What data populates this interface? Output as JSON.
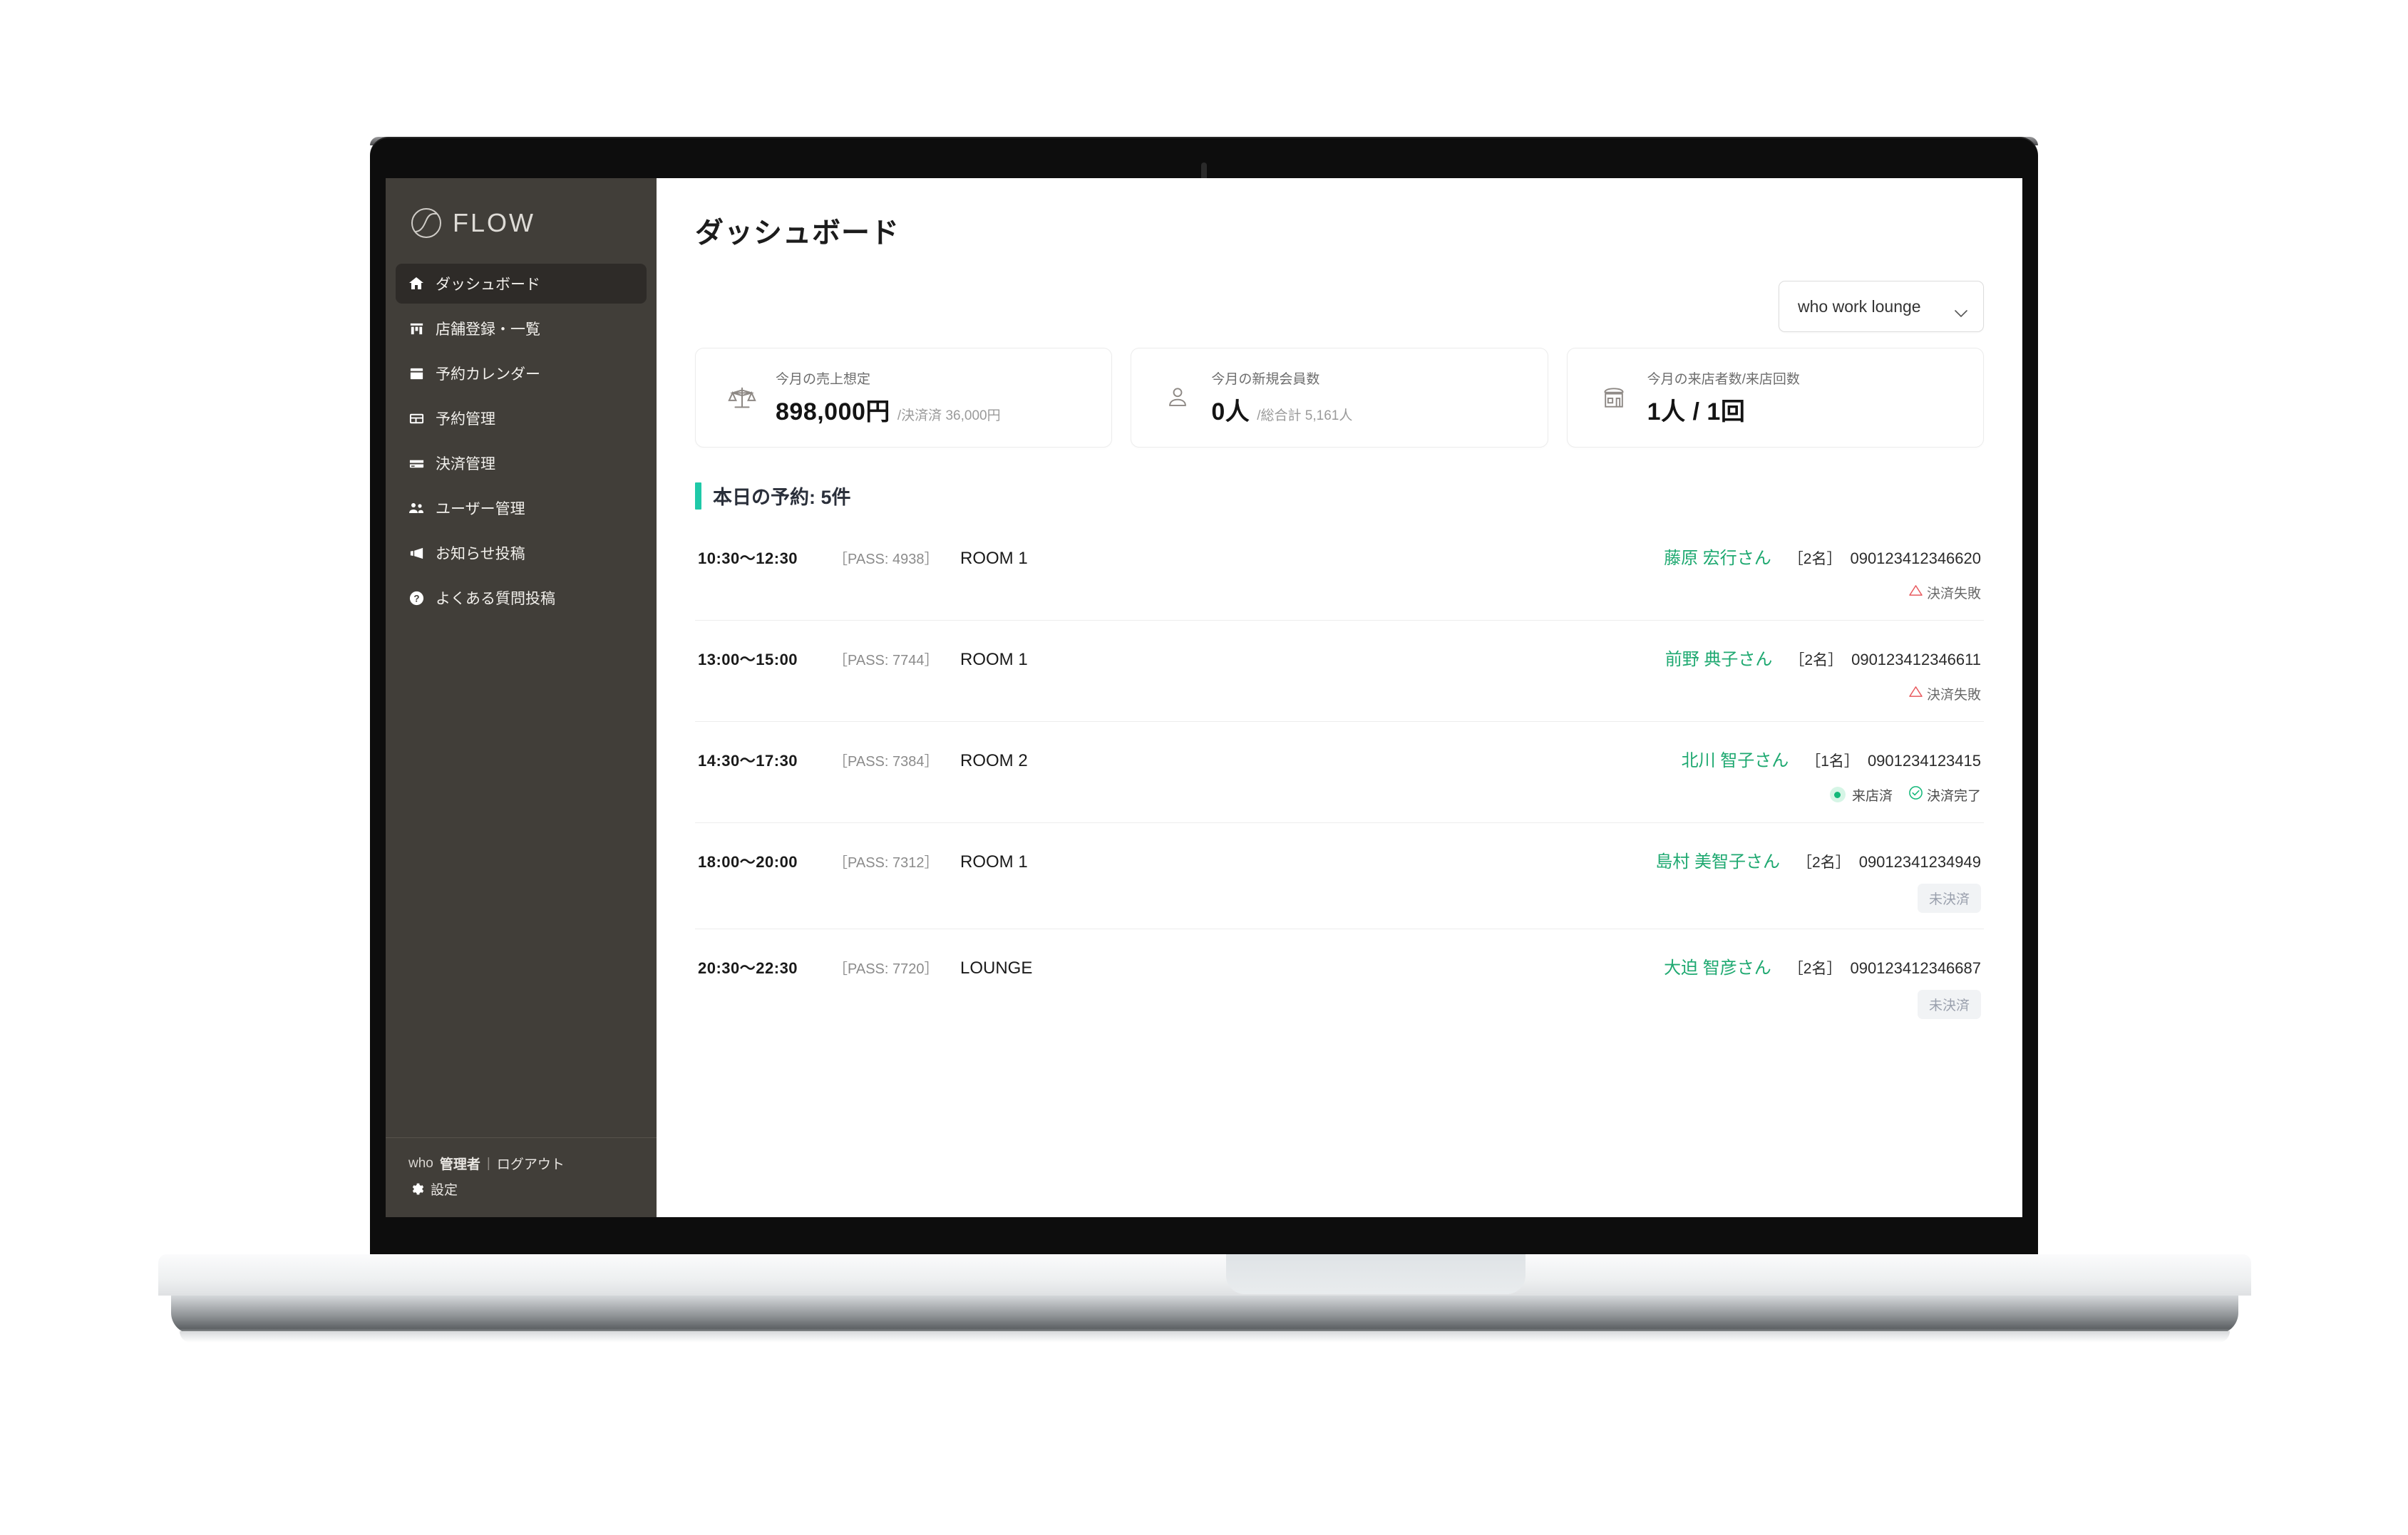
{
  "brand": {
    "name": "FLOW",
    "logo_icon": "circle-swoosh-icon"
  },
  "sidebar": {
    "items": [
      {
        "icon": "home-icon",
        "label": "ダッシュボード",
        "active": true
      },
      {
        "icon": "store-icon",
        "label": "店舗登録・一覧",
        "active": false
      },
      {
        "icon": "calendar-icon",
        "label": "予約カレンダー",
        "active": false
      },
      {
        "icon": "table-icon",
        "label": "予約管理",
        "active": false
      },
      {
        "icon": "credit-card-icon",
        "label": "決済管理",
        "active": false
      },
      {
        "icon": "users-icon",
        "label": "ユーザー管理",
        "active": false
      },
      {
        "icon": "megaphone-icon",
        "label": "お知らせ投稿",
        "active": false
      },
      {
        "icon": "question-circle-icon",
        "label": "よくある質問投稿",
        "active": false
      }
    ],
    "footer": {
      "who": "who",
      "admin": "管理者",
      "separator": "|",
      "logout": "ログアウト",
      "settings": "設定",
      "settings_icon": "gear-icon"
    }
  },
  "header": {
    "title": "ダッシュボード"
  },
  "store_select": {
    "value": "who work lounge",
    "chevron_icon": "chevron-down-icon"
  },
  "cards": [
    {
      "icon": "scales-icon",
      "label": "今月の売上想定",
      "value": "898,000円",
      "sub": "/決済済 36,000円"
    },
    {
      "icon": "person-icon",
      "label": "今月の新規会員数",
      "value": "0人",
      "sub": "/総合計 5,161人"
    },
    {
      "icon": "storefront-icon",
      "label": "今月の来店者数/来店回数",
      "value": "1人 / 1回",
      "sub": ""
    }
  ],
  "section": {
    "title": "本日の予約: 5件",
    "accent_color": "#1fc9a8"
  },
  "reservations": [
    {
      "time": "10:30〜12:30",
      "pass": "［PASS: 4938］",
      "room": "ROOM 1",
      "name": "藤原 宏行さん",
      "count": "［2名］",
      "phone": "090123412346620",
      "badges": [
        {
          "type": "fail",
          "label": "決済失敗",
          "icon": "warning-triangle-icon"
        }
      ]
    },
    {
      "time": "13:00〜15:00",
      "pass": "［PASS: 7744］",
      "room": "ROOM 1",
      "name": "前野 典子さん",
      "count": "［2名］",
      "phone": "090123412346611",
      "badges": [
        {
          "type": "fail",
          "label": "決済失敗",
          "icon": "warning-triangle-icon"
        }
      ]
    },
    {
      "time": "14:30〜17:30",
      "pass": "［PASS: 7384］",
      "room": "ROOM 2",
      "name": "北川 智子さん",
      "count": "［1名］",
      "phone": "0901234123415",
      "badges": [
        {
          "type": "visited",
          "label": "来店済",
          "icon": "green-dot-icon"
        },
        {
          "type": "paid",
          "label": "決済完了",
          "icon": "check-circle-icon"
        }
      ]
    },
    {
      "time": "18:00〜20:00",
      "pass": "［PASS: 7312］",
      "room": "ROOM 1",
      "name": "島村 美智子さん",
      "count": "［2名］",
      "phone": "09012341234949",
      "badges": [
        {
          "type": "unpaid",
          "label": "未決済",
          "icon": ""
        }
      ]
    },
    {
      "time": "20:30〜22:30",
      "pass": "［PASS: 7720］",
      "room": "LOUNGE",
      "name": "大迫 智彦さん",
      "count": "［2名］",
      "phone": "090123412346687",
      "badges": [
        {
          "type": "unpaid",
          "label": "未決済",
          "icon": ""
        }
      ]
    }
  ],
  "colors": {
    "sidebar_bg": "#413e39",
    "sidebar_active": "#2e2b28",
    "accent_green": "#1fc9a8",
    "name_green": "#1fa971",
    "fail_red": "#e8595e",
    "unpaid_gray": "#9aa0ad"
  }
}
